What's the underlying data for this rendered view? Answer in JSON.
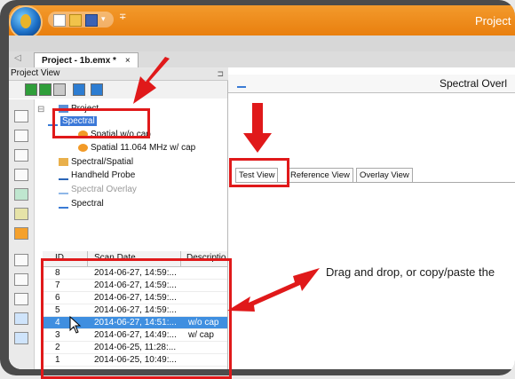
{
  "window": {
    "app_title": "Project",
    "doc_tab": "Project - 1b.emx *",
    "doc_tab_close": "×",
    "tab_scroll_left": "◁"
  },
  "quick_access": {
    "separator": "∓"
  },
  "project_view": {
    "title": "Project View",
    "pin": "⊐",
    "tree": [
      {
        "label": "Project",
        "level": 0,
        "icon": "project-icon"
      },
      {
        "label": "Spectral",
        "level": 1,
        "icon": "spectral-icon",
        "selected": true
      },
      {
        "label": "Spatial w/o cap",
        "level": 2,
        "icon": "spatial-icon"
      },
      {
        "label": "Spatial 11.064 MHz w/ cap",
        "level": 2,
        "icon": "spatial-icon"
      },
      {
        "label": "Spectral/Spatial",
        "level": 1,
        "icon": "spectral-spatial-icon"
      },
      {
        "label": "Handheld Probe",
        "level": 1,
        "icon": "probe-icon"
      },
      {
        "label": "Spectral Overlay",
        "level": 1,
        "icon": "overlay-icon",
        "dim": true
      },
      {
        "label": "Spectral",
        "level": 1,
        "icon": "spectral-icon"
      }
    ],
    "expander": "⊟"
  },
  "scan_table": {
    "headers": [
      "ID",
      "Scan Date",
      "Descriptio"
    ],
    "rows": [
      {
        "id": "8",
        "date": "2014-06-27, 14:59:...",
        "desc": ""
      },
      {
        "id": "7",
        "date": "2014-06-27, 14:59:...",
        "desc": ""
      },
      {
        "id": "6",
        "date": "2014-06-27, 14:59:...",
        "desc": ""
      },
      {
        "id": "5",
        "date": "2014-06-27, 14:59:...",
        "desc": ""
      },
      {
        "id": "4",
        "date": "2014-06-27, 14:51:...",
        "desc": "w/o cap",
        "selected": true
      },
      {
        "id": "3",
        "date": "2014-06-27, 14:49:...",
        "desc": "w/ cap"
      },
      {
        "id": "2",
        "date": "2014-06-25, 11:28:...",
        "desc": ""
      },
      {
        "id": "1",
        "date": "2014-06-25, 10:49:...",
        "desc": ""
      }
    ]
  },
  "right_panel": {
    "title": "Spectral Overl",
    "tabs": [
      "Test View",
      "Reference View",
      "Overlay View"
    ],
    "drag_hint": "Drag and drop, or copy/paste the"
  },
  "colors": {
    "accent": "#e97f0e",
    "annotation": "#e0191a",
    "selection": "#3f8fe0"
  }
}
